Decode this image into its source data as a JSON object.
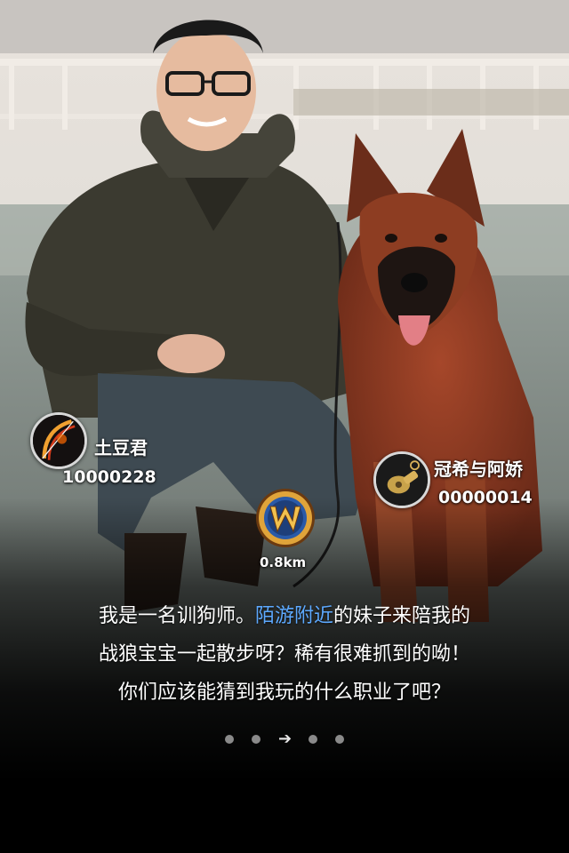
{
  "users": [
    {
      "name": "土豆君",
      "id": "10000228",
      "avatar": "bow-icon"
    },
    {
      "name": "冠希与阿娇",
      "id": "00000014",
      "avatar": "whistle-icon"
    }
  ],
  "center_badge": {
    "distance": "0.8km",
    "icon": "warcraft-w-icon"
  },
  "caption": {
    "line1_pre": "我是一名训狗师。",
    "line1_link": "陌游附近",
    "line1_post": "的妹子来陪我的",
    "line2": "战狼宝宝一起散步呀？稀有很难抓到的呦！",
    "line3": "你们应该能猜到我玩的什么职业了吧？"
  },
  "pager": {
    "total": 5,
    "current": 3
  },
  "colors": {
    "link": "#5da9ff",
    "dot": "#8a8a8a"
  }
}
